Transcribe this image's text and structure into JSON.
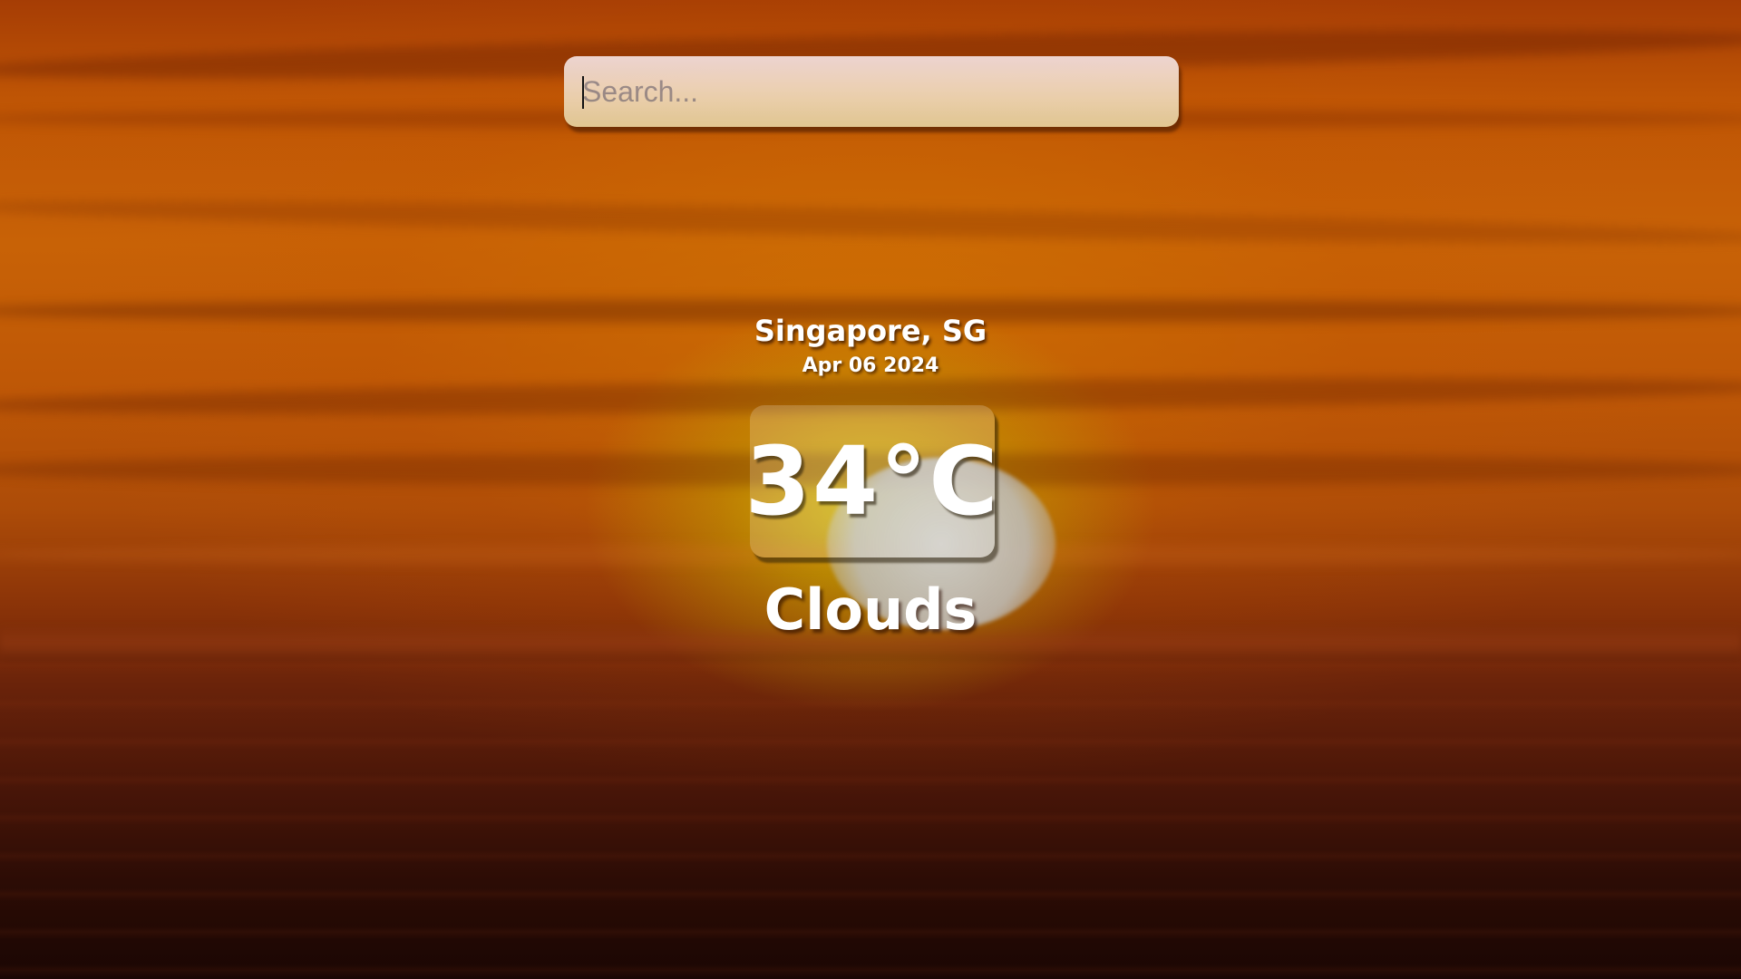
{
  "search": {
    "placeholder": "Search...",
    "value": ""
  },
  "weather": {
    "location": "Singapore, SG",
    "date": "Apr 06 2024",
    "temperature": "34°C",
    "condition": "Clouds"
  },
  "theme": {
    "background": "sunset-over-clouds",
    "text_color": "#ffffff"
  }
}
